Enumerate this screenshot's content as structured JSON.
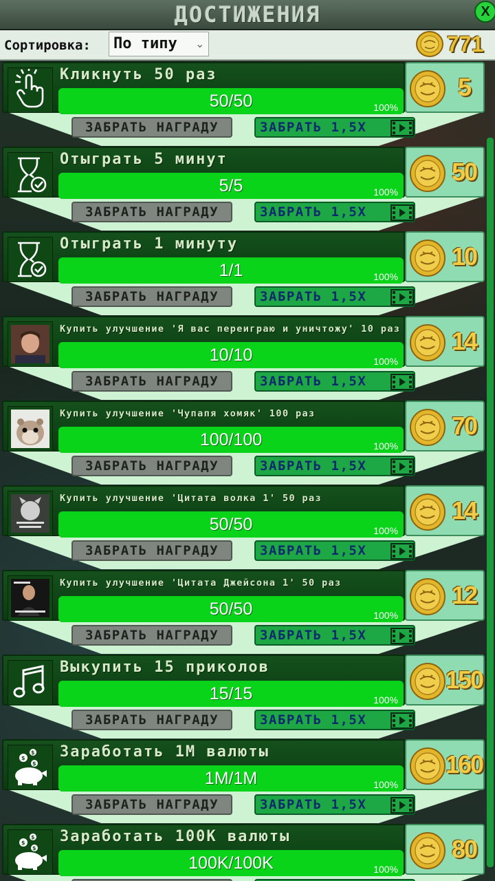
{
  "header": {
    "title": "ДОСТИЖЕНИЯ",
    "close_label": "X"
  },
  "sort": {
    "label": "Сортировка:",
    "value": "По типу"
  },
  "balance": "771",
  "buttons": {
    "claim_label": "ЗАБРАТЬ НАГРАДУ",
    "claim15_label": "ЗАБРАТЬ 1,5Х"
  },
  "achievements": [
    {
      "title": "Кликнуть 50 раз",
      "progress_text": "50/50",
      "percent": "100%",
      "reward": "5",
      "icon": "hand-click-icon",
      "fill": 1.0
    },
    {
      "title": "Отыграть 5 минут",
      "progress_text": "5/5",
      "percent": "100%",
      "reward": "50",
      "icon": "hourglass-check-icon",
      "fill": 1.0
    },
    {
      "title": "Отыграть 1 минуту",
      "progress_text": "1/1",
      "percent": "100%",
      "reward": "10",
      "icon": "hourglass-check-icon",
      "fill": 1.0
    },
    {
      "title": "Купить улучшение 'Я вас переиграю и уничтожу' 10 раз",
      "progress_text": "10/10",
      "percent": "100%",
      "reward": "14",
      "icon": "portrait-man-icon",
      "fill": 1.0
    },
    {
      "title": "Купить улучшение 'Чупапя хомяк' 100 раз",
      "progress_text": "100/100",
      "percent": "100%",
      "reward": "70",
      "icon": "hamster-photo-icon",
      "fill": 1.0
    },
    {
      "title": "Купить улучшение 'Цитата волка 1' 50 раз",
      "progress_text": "50/50",
      "percent": "100%",
      "reward": "14",
      "icon": "wolf-quote-icon",
      "fill": 1.0
    },
    {
      "title": "Купить улучшение 'Цитата Джейсона 1' 50 раз",
      "progress_text": "50/50",
      "percent": "100%",
      "reward": "12",
      "icon": "jason-quote-icon",
      "fill": 1.0
    },
    {
      "title": "Выкупить 15 приколов",
      "progress_text": "15/15",
      "percent": "100%",
      "reward": "150",
      "icon": "music-note-icon",
      "fill": 1.0
    },
    {
      "title": "Заработать 1М валюты",
      "progress_text": "1M/1M",
      "percent": "100%",
      "reward": "160",
      "icon": "piggy-bank-icon",
      "fill": 1.0
    },
    {
      "title": "Заработать 100К валюты",
      "progress_text": "100K/100K",
      "percent": "100%",
      "reward": "80",
      "icon": "piggy-bank-icon",
      "fill": 1.0
    }
  ]
}
